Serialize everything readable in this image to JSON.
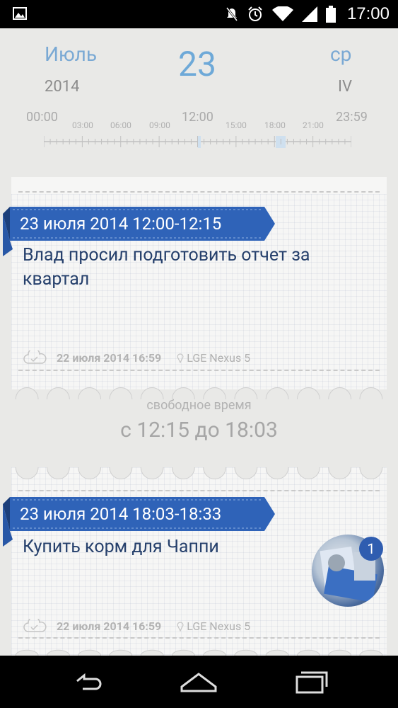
{
  "status_bar": {
    "time": "17:00",
    "icons": [
      "image-icon",
      "mute-icon",
      "alarm-icon",
      "wifi-icon",
      "signal-icon",
      "battery-icon"
    ]
  },
  "header": {
    "month": "Июль",
    "year": "2014",
    "day": "23",
    "weekday": "ср",
    "week_number": "IV"
  },
  "timeline": {
    "start": "00:00",
    "end": "23:59",
    "mid": "12:00",
    "ticks": [
      "03:00",
      "06:00",
      "09:00",
      "15:00",
      "18:00",
      "21:00"
    ]
  },
  "events": [
    {
      "time_range": "23 июля 2014 12:00-12:15",
      "title": "Влад просил подготовить отчет за квартал",
      "sync_date": "22 июля 2014 16:59",
      "device": "LGE Nexus 5"
    },
    {
      "time_range": "23 июля 2014 18:03-18:33",
      "title": "Купить корм для Чаппи",
      "sync_date": "22 июля 2014 16:59",
      "device": "LGE Nexus 5",
      "attachments_count": "1"
    }
  ],
  "free_time": {
    "label": "свободное время",
    "range": "с 12:15 до 18:03"
  },
  "colors": {
    "accent": "#6ea9d8",
    "ribbon": "#2f63b8",
    "title_text": "#26406c"
  },
  "nav_bar": {
    "icons": [
      "back-icon",
      "home-icon",
      "recents-icon"
    ]
  }
}
